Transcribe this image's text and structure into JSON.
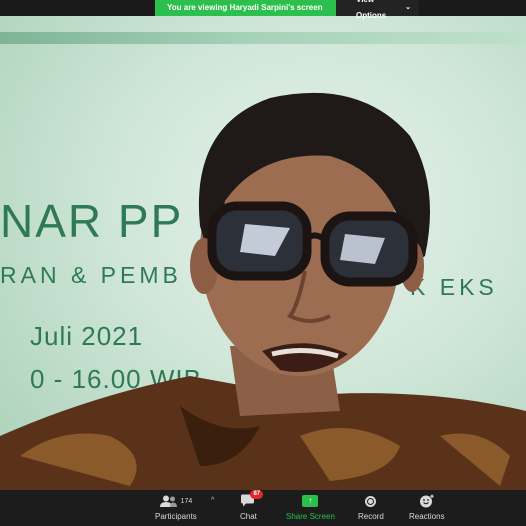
{
  "banner": {
    "message": "You are viewing Haryadi Sarpini's screen",
    "options_label": "View Options"
  },
  "slide": {
    "line1": "NAR PP",
    "line2": "RAN & PEMB",
    "line3": "Juli 2021",
    "line4": "0 - 16.00 WIB",
    "line5": "K EKS"
  },
  "toolbar": {
    "participants_label": "Participants",
    "participants_count": "174",
    "chat_label": "Chat",
    "chat_badge": "87",
    "share_label": "Share Screen",
    "record_label": "Record",
    "reactions_label": "Reactions"
  },
  "colors": {
    "accent": "#2dbf4d",
    "toolbar_bg": "#1c1c1c",
    "badge": "#e02828",
    "slide_text": "#2f7a55"
  }
}
